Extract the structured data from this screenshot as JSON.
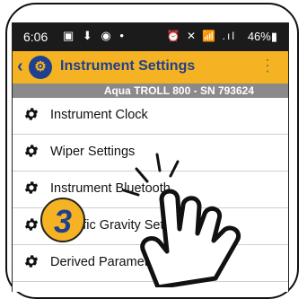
{
  "status_bar": {
    "time": "6:06",
    "left_icons": "▣ ⬇ ◉ •",
    "right_icons": "⏰ ✕ 📶 .ıl",
    "battery": "46%▮"
  },
  "app_bar": {
    "title": "Instrument Settings",
    "back_icon": "‹",
    "menu_icon": "⋮"
  },
  "device_bar": {
    "label": "Aqua TROLL 800 - SN 793624"
  },
  "menu_items": [
    {
      "label": "Instrument Clock"
    },
    {
      "label": "Wiper Settings"
    },
    {
      "label": "Instrument Bluetooth"
    },
    {
      "label": "Specific Gravity Setting"
    },
    {
      "label": "Derived Parameters"
    }
  ],
  "step_badge": "3",
  "colors": {
    "accent": "#f5b323",
    "brand_blue": "#1f3f8f",
    "status_bar": "#1b1b1b",
    "device_bar": "#8a8a8a"
  }
}
